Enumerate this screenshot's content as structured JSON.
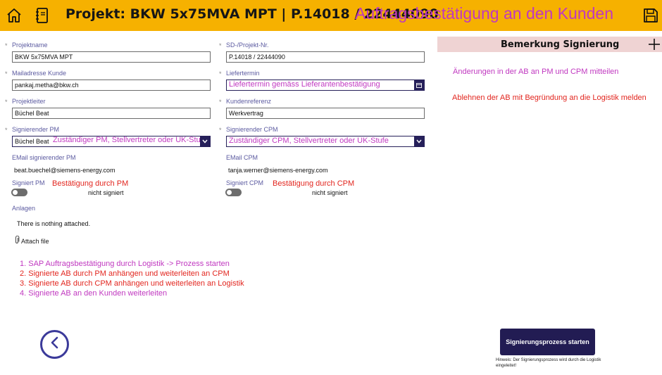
{
  "header": {
    "title": "Projekt: BKW 5x75MVA MPT | P.14018 / 22444090",
    "subtitle": "Auftragsbestätigung an den Kunden",
    "home_icon": "home-icon",
    "notebook_icon": "notebook-icon",
    "save_icon": "save-icon",
    "bar_color": "#f6b100"
  },
  "form": {
    "projektname": {
      "label": "Projektname",
      "value": "BKW 5x75MVA MPT"
    },
    "sd_nr": {
      "label": "SD-/Projekt-Nr.",
      "value": "P.14018 / 22444090"
    },
    "mail_kunde": {
      "label": "Mailadresse Kunde",
      "value": "pankaj.metha@bkw.ch"
    },
    "liefertermin": {
      "label": "Liefertermin",
      "value": "Liefertermin gemäss Lieferantenbestätigung"
    },
    "projektleiter": {
      "label": "Projektleiter",
      "value": "Büchel Beat"
    },
    "kundenreferenz": {
      "label": "Kundenreferenz",
      "value": "Werkvertrag"
    },
    "signierender_pm": {
      "label": "Signierender PM",
      "value": "Büchel Beat",
      "hint": "Zuständiger PM, Stellvertreter oder UK-Stufe"
    },
    "signierender_cpm": {
      "label": "Signierender CPM",
      "value": "Zuständiger CPM, Stellvertreter oder UK-Stufe"
    },
    "email_pm": {
      "label": "EMail signierender PM",
      "value": "beat.buechel@siemens-energy.com"
    },
    "email_cpm": {
      "label": "EMail CPM",
      "value": "tanja.werner@siemens-energy.com"
    },
    "signiert_pm": {
      "label": "Signiert PM",
      "hint": "Bestätigung durch PM",
      "status": "nicht signiert"
    },
    "signiert_cpm": {
      "label": "Signiert CPM",
      "hint": "Bestätigung durch CPM",
      "status": "nicht signiert"
    },
    "anlagen": {
      "label": "Anlagen",
      "empty": "There is nothing attached.",
      "attach": "Attach file"
    }
  },
  "steps": [
    {
      "text": "1. SAP Auftragsbestätigung durch Logistik -> Prozess starten",
      "color": "#c038c0"
    },
    {
      "text": "2. Signierte AB durch PM anhängen und weiterleiten an CPM",
      "color": "#e2261f"
    },
    {
      "text": "3. Signierte AB durch CPM anhängen und weiterleiten an Logistik",
      "color": "#e2261f"
    },
    {
      "text": "4. Signierte AB an den Kunden weiterleiten",
      "color": "#c038c0"
    }
  ],
  "panel": {
    "title": "Bemerkung Signierung",
    "note1": "Änderungen in der AB an PM und CPM mitteilen",
    "note2": "Ablehnen der AB mit Begründung an die Logistik melden"
  },
  "footer": {
    "start_label": "Signierungsprozess starten",
    "hint": "Hinweis: Der Signierungsprozess wird durch die Logistik eingeleitet!"
  }
}
